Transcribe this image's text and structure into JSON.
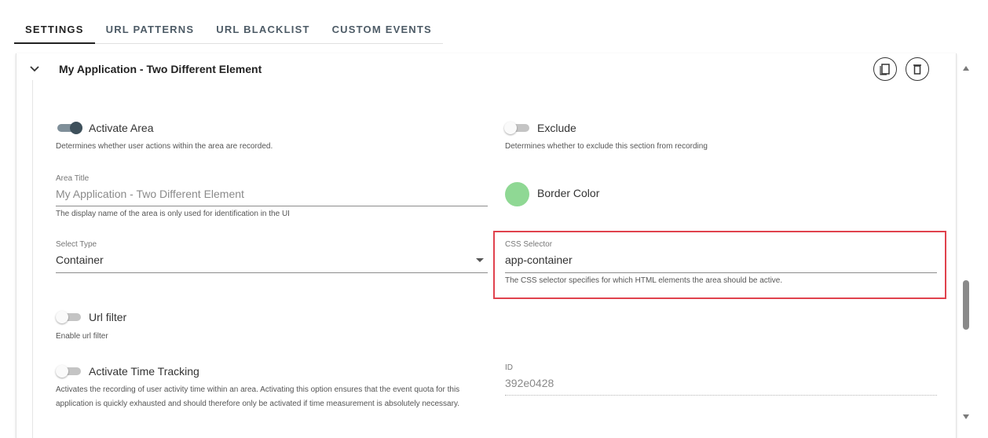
{
  "tabs": [
    {
      "label": "SETTINGS",
      "active": true
    },
    {
      "label": "URL PATTERNS",
      "active": false
    },
    {
      "label": "URL BLACKLIST",
      "active": false
    },
    {
      "label": "CUSTOM EVENTS",
      "active": false
    }
  ],
  "panel": {
    "title": "My Application - Two Different Element",
    "actions": {
      "copy_icon": "copy-icon",
      "delete_icon": "trash-icon"
    }
  },
  "activate_area": {
    "label": "Activate Area",
    "on": true,
    "hint": "Determines whether user actions within the area are recorded."
  },
  "exclude": {
    "label": "Exclude",
    "on": false,
    "hint": "Determines whether to exclude this section from recording"
  },
  "area_title": {
    "label": "Area Title",
    "value": "My Application - Two Different Element",
    "hint": "The display name of the area is only used for identification in the UI"
  },
  "border_color": {
    "label": "Border Color",
    "color": "#8fd894"
  },
  "select_type": {
    "label": "Select Type",
    "value": "Container"
  },
  "css_selector": {
    "label": "CSS Selector",
    "value": "app-container",
    "hint": "The CSS selector specifies for which HTML elements the area should be active."
  },
  "url_filter": {
    "label": "Url filter",
    "on": false,
    "hint": "Enable url filter"
  },
  "time_tracking": {
    "label": "Activate Time Tracking",
    "on": false,
    "hint": "Activates the recording of user activity time within an area. Activating this option ensures that the event quota for this application is quickly exhausted and should therefore only be activated if time measurement is absolutely necessary."
  },
  "id_field": {
    "label": "ID",
    "value": "392e0428"
  },
  "colors": {
    "highlight": "#e0424d",
    "toggle_on": "#3e505b",
    "border_color_swatch": "#8fd894"
  }
}
